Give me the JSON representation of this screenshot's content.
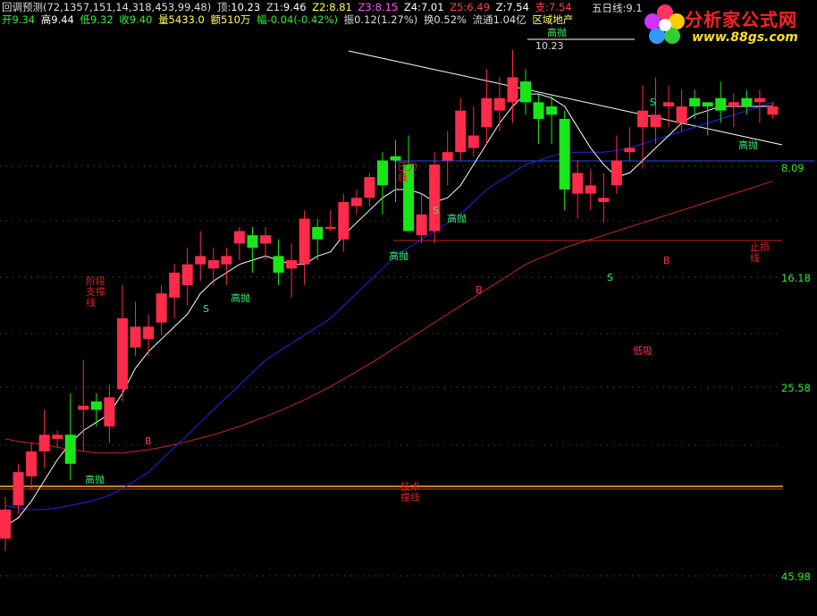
{
  "header": {
    "indicator_name": "回调预测(72,1357,151,14,318,453,99,48)",
    "top_label": "顶:",
    "top_value": "10.23",
    "z1_label": "Z1:",
    "z1_value": "9.46",
    "z2_label": "Z2:",
    "z2_value": "8.81",
    "z3_label": "Z3:",
    "z3_value": "8.15",
    "z4_label": "Z4:",
    "z4_value": "7.01",
    "z5_label": "Z5:",
    "z5_value": "6.49",
    "z_label": "Z:",
    "z_value": "7.54",
    "support_label": "支:",
    "support_value": "7.54",
    "five_day_label": "五日线:",
    "five_day_value": "9.1"
  },
  "quote": {
    "open": "开9.34",
    "high": "高9.44",
    "low": "低9.32",
    "close": "收9.40",
    "volume": "量5433.0",
    "amount": "额510万",
    "change": "幅-0.04(-0.42%)",
    "amplitude": "振0.12(1.27%)",
    "turnover": "换0.52%",
    "float": "流通1.04亿",
    "sector": "区域地产"
  },
  "logo": {
    "title": "分析家公式网",
    "url": "www.88gs.com"
  },
  "y_labels": [
    "8.09",
    "16.18",
    "25.58",
    "45.98"
  ],
  "colors": {
    "up": "#ff2b4b",
    "down": "#19e619",
    "ma_white": "#ffffff",
    "ma_blue": "#2222ee",
    "ma_red": "#cc2222",
    "support_line": "#ffaa44",
    "signal_green": "#33ee66",
    "signal_red": "#ff3355"
  },
  "chart_data": {
    "type": "candlestick",
    "candles": [
      [
        4.35,
        4.7,
        4.2,
        4.85
      ],
      [
        4.75,
        5.15,
        4.65,
        5.25
      ],
      [
        5.1,
        5.4,
        4.95,
        5.5
      ],
      [
        5.4,
        5.6,
        5.2,
        5.9
      ],
      [
        5.55,
        5.6,
        5.45,
        5.65
      ],
      [
        5.6,
        5.25,
        5.05,
        6.1
      ],
      [
        5.9,
        5.95,
        5.4,
        6.5
      ],
      [
        6.0,
        5.9,
        5.7,
        6.1
      ],
      [
        5.7,
        6.05,
        5.5,
        6.2
      ],
      [
        6.15,
        7.0,
        6.0,
        7.4
      ],
      [
        6.65,
        6.9,
        6.55,
        7.2
      ],
      [
        6.75,
        6.9,
        6.55,
        7.05
      ],
      [
        6.95,
        7.3,
        6.8,
        7.4
      ],
      [
        7.25,
        7.55,
        7.0,
        7.65
      ],
      [
        7.4,
        7.65,
        7.15,
        7.85
      ],
      [
        7.65,
        7.75,
        7.45,
        8.05
      ],
      [
        7.6,
        7.7,
        7.4,
        7.85
      ],
      [
        7.65,
        7.75,
        7.4,
        7.85
      ],
      [
        7.9,
        8.05,
        7.7,
        8.1
      ],
      [
        8.0,
        7.85,
        7.55,
        8.1
      ],
      [
        7.9,
        8.0,
        7.7,
        8.1
      ],
      [
        7.75,
        7.55,
        7.4,
        7.95
      ],
      [
        7.6,
        7.7,
        7.25,
        7.9
      ],
      [
        7.65,
        8.2,
        7.4,
        8.3
      ],
      [
        8.1,
        7.95,
        7.7,
        8.2
      ],
      [
        8.1,
        8.1,
        8.05,
        8.3
      ],
      [
        7.95,
        8.4,
        7.8,
        8.5
      ],
      [
        8.35,
        8.45,
        8.25,
        8.55
      ],
      [
        8.45,
        8.7,
        8.35,
        8.75
      ],
      [
        8.9,
        8.6,
        8.25,
        9.0
      ],
      [
        8.95,
        8.9,
        8.4,
        9.15
      ],
      [
        8.85,
        8.05,
        8.6,
        9.2
      ],
      [
        8.0,
        8.25,
        7.9,
        8.5
      ],
      [
        8.05,
        8.85,
        7.9,
        9.0
      ],
      [
        8.9,
        9.0,
        8.6,
        9.25
      ],
      [
        9.0,
        9.5,
        8.9,
        9.65
      ],
      [
        9.05,
        9.2,
        8.95,
        9.55
      ],
      [
        9.3,
        9.65,
        9.1,
        10.0
      ],
      [
        9.5,
        9.65,
        9.25,
        9.9
      ],
      [
        9.6,
        9.9,
        9.35,
        10.23
      ],
      [
        9.85,
        9.6,
        9.45,
        10.0
      ],
      [
        9.6,
        9.4,
        9.1,
        9.7
      ],
      [
        9.55,
        9.45,
        9.1,
        9.7
      ],
      [
        9.4,
        8.55,
        8.3,
        9.5
      ],
      [
        8.5,
        8.75,
        8.2,
        8.9
      ],
      [
        8.5,
        8.6,
        8.3,
        8.8
      ],
      [
        8.4,
        8.45,
        8.15,
        8.75
      ],
      [
        8.6,
        8.9,
        8.5,
        9.2
      ],
      [
        9.0,
        9.05,
        8.9,
        9.3
      ],
      [
        9.3,
        9.5,
        8.8,
        9.8
      ],
      [
        9.3,
        9.45,
        9.1,
        9.9
      ],
      [
        9.55,
        9.6,
        9.3,
        9.8
      ],
      [
        9.35,
        9.55,
        9.25,
        9.75
      ],
      [
        9.65,
        9.55,
        9.4,
        9.75
      ],
      [
        9.6,
        9.55,
        9.2,
        9.6
      ],
      [
        9.65,
        9.5,
        9.35,
        9.85
      ],
      [
        9.55,
        9.6,
        9.3,
        9.7
      ],
      [
        9.65,
        9.55,
        9.45,
        9.75
      ],
      [
        9.6,
        9.65,
        9.35,
        9.75
      ],
      [
        9.45,
        9.55,
        9.4,
        9.6
      ]
    ],
    "ma_white": [
      4.5,
      4.6,
      4.8,
      5.05,
      5.3,
      5.5,
      5.65,
      5.75,
      5.85,
      6.1,
      6.4,
      6.6,
      6.75,
      6.9,
      7.05,
      7.3,
      7.45,
      7.55,
      7.65,
      7.7,
      7.75,
      7.7,
      7.65,
      7.65,
      7.75,
      7.8,
      8.0,
      8.15,
      8.3,
      8.45,
      8.55,
      8.55,
      8.5,
      8.4,
      8.45,
      8.6,
      8.85,
      9.1,
      9.35,
      9.55,
      9.7,
      9.7,
      9.65,
      9.55,
      9.3,
      9.05,
      8.85,
      8.7,
      8.75,
      8.9,
      9.05,
      9.2,
      9.35,
      9.45,
      9.5,
      9.55,
      9.55,
      9.55,
      9.55,
      9.55
    ],
    "ma_blue": [
      4.75,
      4.72,
      4.7,
      4.7,
      4.72,
      4.75,
      4.78,
      4.82,
      4.87,
      4.95,
      5.05,
      5.15,
      5.3,
      5.45,
      5.6,
      5.75,
      5.9,
      6.05,
      6.2,
      6.35,
      6.5,
      6.6,
      6.7,
      6.8,
      6.9,
      7.0,
      7.15,
      7.3,
      7.45,
      7.6,
      7.75,
      7.85,
      7.95,
      8.05,
      8.15,
      8.25,
      8.4,
      8.55,
      8.65,
      8.75,
      8.85,
      8.9,
      8.95,
      9.0,
      9.0,
      9.0,
      9.0,
      9.02,
      9.05,
      9.1,
      9.15,
      9.2,
      9.25,
      9.3,
      9.35,
      9.4,
      9.45,
      9.5,
      9.55,
      9.6
    ],
    "ma_red": [
      5.55,
      5.52,
      5.5,
      5.48,
      5.45,
      5.42,
      5.4,
      5.38,
      5.38,
      5.38,
      5.4,
      5.42,
      5.45,
      5.48,
      5.52,
      5.56,
      5.6,
      5.65,
      5.7,
      5.76,
      5.82,
      5.88,
      5.95,
      6.02,
      6.1,
      6.18,
      6.27,
      6.36,
      6.45,
      6.55,
      6.65,
      6.75,
      6.85,
      6.95,
      7.05,
      7.15,
      7.25,
      7.35,
      7.45,
      7.55,
      7.65,
      7.72,
      7.78,
      7.85,
      7.9,
      7.95,
      8.0,
      8.05,
      8.1,
      8.15,
      8.2,
      8.25,
      8.3,
      8.35,
      8.4,
      8.45,
      8.5,
      8.55,
      8.6,
      8.65
    ]
  },
  "annotations": {
    "high_sell": "高抛",
    "low_buy": "低吸",
    "buy_mark": "B",
    "sell_mark": "S",
    "stage_support": "阶段\n支撑\n线",
    "tech_support": "技术\n撑线",
    "pressure_line": "压力\n线",
    "up_resist": "止损\n线",
    "peak_value": "10.23"
  }
}
